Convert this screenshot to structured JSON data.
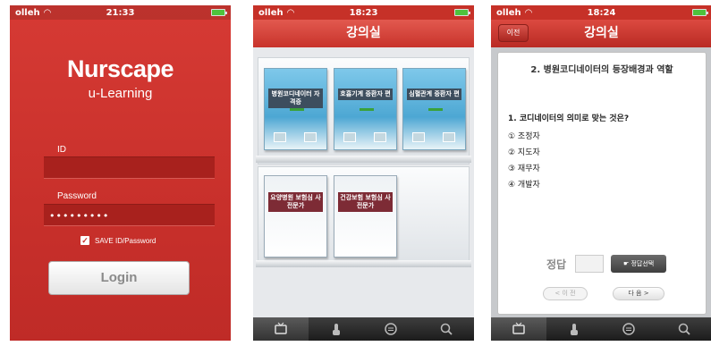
{
  "colors": {
    "brand_red": "#c8302b",
    "tab_dark": "#2a2a2a",
    "book_blue": "#5aafd8"
  },
  "login": {
    "status": {
      "carrier": "olleh",
      "time": "21:33"
    },
    "logo": "Nurscape",
    "logo_sub": "u-Learning",
    "id_label": "ID",
    "id_value": "",
    "password_label": "Password",
    "password_value": "•••••••••",
    "save_label": "SAVE  ID/Password",
    "save_checked": true,
    "login_button": "Login"
  },
  "classroom": {
    "status": {
      "carrier": "olleh",
      "time": "18:23"
    },
    "title": "강의실",
    "books": [
      {
        "title": "병원코디네이터 자격증"
      },
      {
        "title": "호흡기계 중환자 편"
      },
      {
        "title": "심혈관계 중환자 편"
      },
      {
        "title": "요양병원 보험심 사전문가"
      },
      {
        "title": "건강보험 보험심 사전문가"
      }
    ],
    "tabs": [
      "tv-icon",
      "touch-icon",
      "chat-icon",
      "search-icon"
    ]
  },
  "quiz": {
    "status": {
      "carrier": "olleh",
      "time": "18:24"
    },
    "title": "강의실",
    "back_label": "이전",
    "heading": "2. 병원코디네이터의 등장배경과 역할",
    "question": "1. 코디네이터의 의미로 맞는 것은?",
    "options": [
      "① 조정자",
      "② 지도자",
      "③ 재무자",
      "④ 개발자"
    ],
    "answer_label": "정답",
    "answer_value": "",
    "select_button": "정답선택",
    "prev_button": "< 이 전",
    "next_button": "다 음 >"
  }
}
